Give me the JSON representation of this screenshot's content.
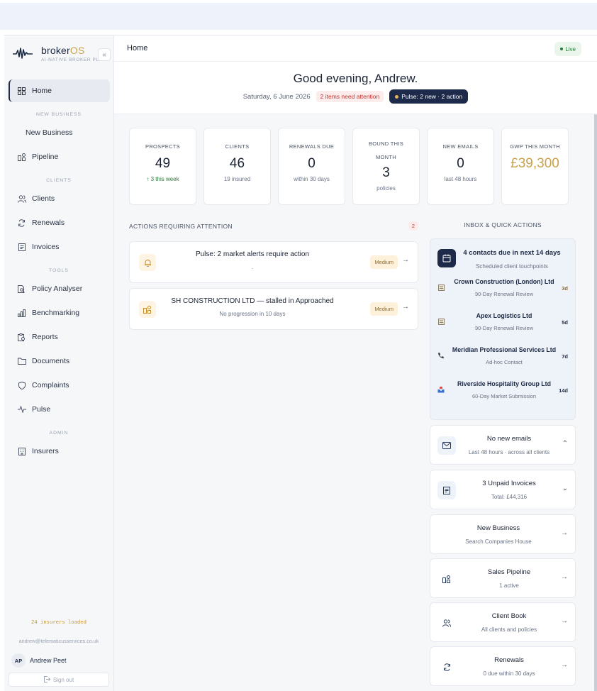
{
  "brand": {
    "name_prefix": "broker",
    "name_suffix": "OS",
    "tagline": "AI-NATIVE BROKER PLAT",
    "collapse_label": "«"
  },
  "sidebar": {
    "home": "Home",
    "section_new_business": "NEW BUSINESS",
    "new_business": "New Business",
    "pipeline": "Pipeline",
    "section_clients": "CLIENTS",
    "clients": "Clients",
    "renewals": "Renewals",
    "invoices": "Invoices",
    "section_tools": "TOOLS",
    "policy_analyser": "Policy Analyser",
    "benchmarking": "Benchmarking",
    "reports": "Reports",
    "documents": "Documents",
    "complaints": "Complaints",
    "pulse": "Pulse",
    "section_admin": "ADMIN",
    "insurers": "Insurers",
    "insurers_loaded": "24 insurers loaded",
    "user_email": "andrew@telematicusservices.co.uk",
    "user_initials": "AP",
    "user_name": "Andrew Peet",
    "sign_out": "Sign out"
  },
  "topbar": {
    "title": "Home",
    "live": "Live"
  },
  "greeting": {
    "title": "Good evening, Andrew.",
    "date": "Saturday, 6 June 2026",
    "attention": "2 items need attention",
    "pulse": "Pulse: 2 new · 2 action"
  },
  "stats": {
    "prospects": {
      "label": "PROSPECTS",
      "value": "49",
      "sub": "↑ 3 this week"
    },
    "clients": {
      "label": "CLIENTS",
      "value": "46",
      "sub": "19 insured"
    },
    "renewals": {
      "label": "RENEWALS DUE",
      "value": "0",
      "sub": "within 30 days"
    },
    "bound": {
      "label": "BOUND THIS MONTH",
      "value": "3",
      "sub": "policies"
    },
    "emails": {
      "label": "NEW EMAILS",
      "value": "0",
      "sub": "last 48 hours"
    },
    "gwp": {
      "label": "GWP THIS MONTH",
      "value": "£39,300"
    }
  },
  "actions": {
    "title": "ACTIONS REQUIRING ATTENTION",
    "count": "2",
    "items": [
      {
        "title": "Pulse: 2 market alerts require action",
        "sub": ".",
        "priority": "Medium"
      },
      {
        "title": "SH CONSTRUCTION LTD — stalled in Approached",
        "sub": "No progression in 10 days",
        "priority": "Medium"
      }
    ]
  },
  "inbox": {
    "title": "INBOX & QUICK ACTIONS",
    "contacts_title": "4 contacts due in next 14 days",
    "contacts_sub": "Scheduled client touchpoints",
    "contacts": [
      {
        "name": "Crown Construction (London) Ltd",
        "sub": "90-Day Renewal Review",
        "days": "3d"
      },
      {
        "name": "Apex Logistics Ltd",
        "sub": "90-Day Renewal Review",
        "days": "5d"
      },
      {
        "name": "Meridian Professional Services Ltd",
        "sub": "Ad-hoc Contact",
        "days": "7d"
      },
      {
        "name": "Riverside Hospitality Group Ltd",
        "sub": "60-Day Market Submission",
        "days": "14d"
      }
    ],
    "emails_title": "No new emails",
    "emails_sub": "Last 48 hours · across all clients",
    "invoices_title": "3 Unpaid Invoices",
    "invoices_sub": "Total: £44,316",
    "newbiz_title": "New Business",
    "newbiz_sub": "Search Companies House",
    "pipeline_title": "Sales Pipeline",
    "pipeline_sub": "1 active",
    "clientbook_title": "Client Book",
    "clientbook_sub": "All clients and policies",
    "renewals_title": "Renewals",
    "renewals_sub": "0 due within 30 days"
  }
}
